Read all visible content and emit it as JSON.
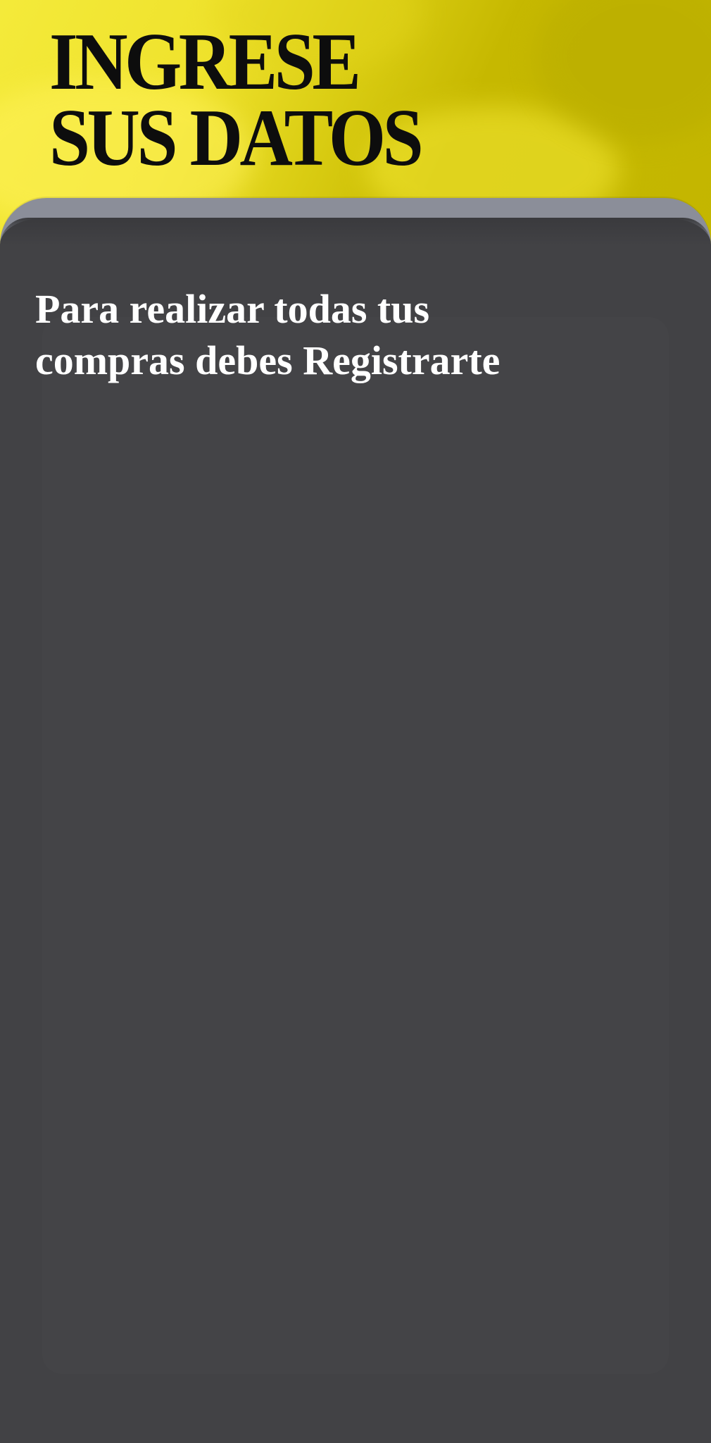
{
  "header": {
    "title_line_1": "INGRESE",
    "title_line_2": "SUS DATOS",
    "accent_color": "#f0e42a"
  },
  "main": {
    "message_line_1": "Para realizar todas tus",
    "message_line_2": "compras debes Registrarte",
    "panel_color": "#424245",
    "panel_border_color": "#8b8e99"
  }
}
